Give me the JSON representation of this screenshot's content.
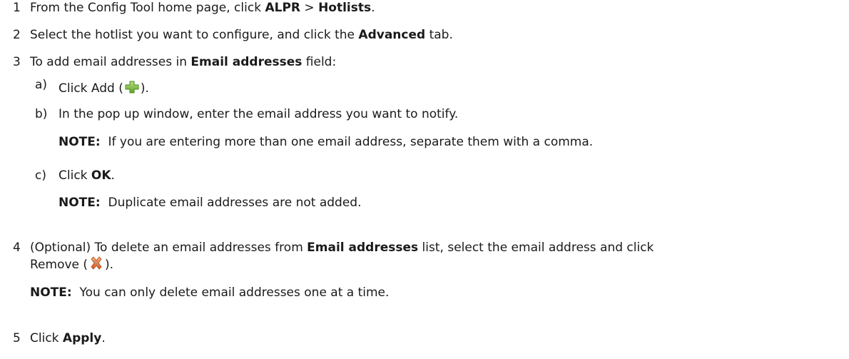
{
  "steps": [
    {
      "num": "1",
      "p1": "From the Config Tool home page, click ",
      "b1": "ALPR",
      "p2": " > ",
      "b2": "Hotlists",
      "p3": "."
    },
    {
      "num": "2",
      "p1": "Select the hotlist you want to configure, and click the ",
      "b1": "Advanced",
      "p2": " tab."
    },
    {
      "num": "3",
      "p1": "To add email addresses in ",
      "b1": "Email addresses",
      "p2": " field:",
      "substeps": [
        {
          "letter": "a)",
          "p1": "Click Add (",
          "p2": ")."
        },
        {
          "letter": "b)",
          "p1": "In the pop up window, enter the email address you want to notify.",
          "note_label": "NOTE:",
          "note_text": "If you are entering more than one email address, separate them with a comma."
        },
        {
          "letter": "c)",
          "p1": "Click ",
          "b1": "OK",
          "p2": ".",
          "note_label": "NOTE:",
          "note_text": "Duplicate email addresses are not added."
        }
      ]
    },
    {
      "num": "4",
      "p1": "(Optional) To delete an email addresses from ",
      "b1": "Email addresses",
      "p2": " list, select the email address and click",
      "line2_p1": "Remove (",
      "line2_p2": ").",
      "note_label": "NOTE:",
      "note_text": "You can only delete email addresses one at a time."
    },
    {
      "num": "5",
      "p1": "Click ",
      "b1": "Apply",
      "p2": "."
    }
  ],
  "icons": {
    "add": "plus-icon",
    "remove": "x-icon",
    "add_color": "#7fc241",
    "remove_color": "#e8742f"
  }
}
